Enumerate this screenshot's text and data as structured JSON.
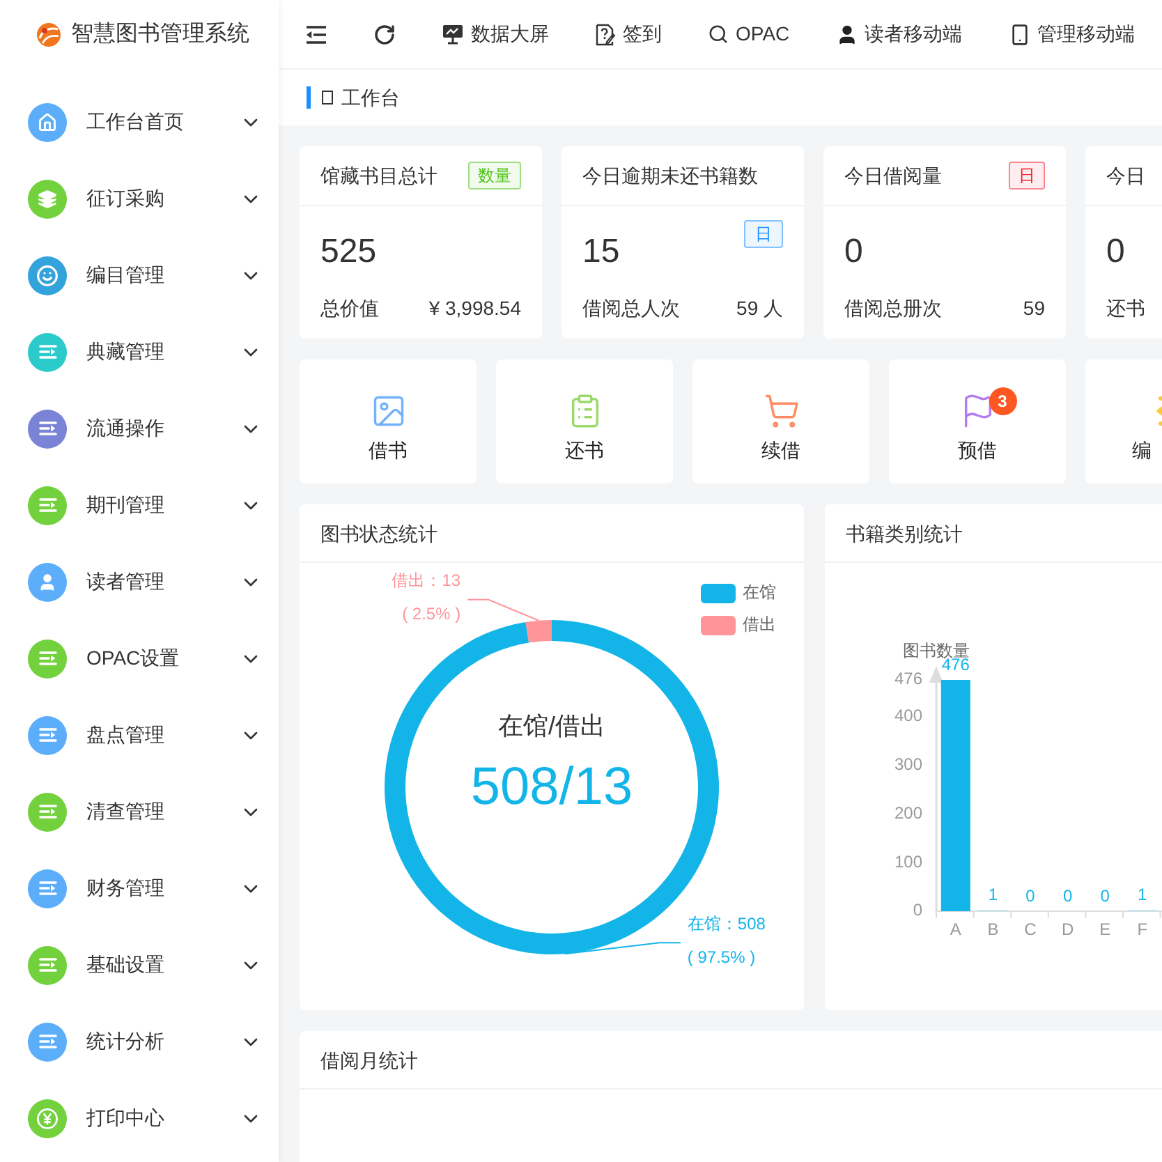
{
  "app": {
    "title": "智慧图书管理系统"
  },
  "toolbar": {
    "items": [
      {
        "kind": "indent"
      },
      {
        "kind": "refresh"
      },
      {
        "kind": "monitor",
        "label": "数据大屏"
      },
      {
        "kind": "document",
        "label": "签到"
      },
      {
        "kind": "search",
        "label": "OPAC"
      },
      {
        "kind": "user",
        "label": "读者移动端"
      },
      {
        "kind": "phone",
        "label": "管理移动端"
      }
    ]
  },
  "sidebar": {
    "items": [
      {
        "label": "工作台首页",
        "kind": "home",
        "color": "#5caefa"
      },
      {
        "label": "征订采购",
        "kind": "layers",
        "color": "#72d13c"
      },
      {
        "label": "编目管理",
        "kind": "smile",
        "color": "#33a3dc"
      },
      {
        "label": "典藏管理",
        "kind": "list",
        "color": "#2ccbcb"
      },
      {
        "label": "流通操作",
        "kind": "list",
        "color": "#7b83d6"
      },
      {
        "label": "期刊管理",
        "kind": "list",
        "color": "#72d13c"
      },
      {
        "label": "读者管理",
        "kind": "user",
        "color": "#5caefa"
      },
      {
        "label": "OPAC设置",
        "kind": "list",
        "color": "#72d13c"
      },
      {
        "label": "盘点管理",
        "kind": "list",
        "color": "#5caefa"
      },
      {
        "label": "清查管理",
        "kind": "list",
        "color": "#72d13c"
      },
      {
        "label": "财务管理",
        "kind": "list",
        "color": "#5caefa"
      },
      {
        "label": "基础设置",
        "kind": "list",
        "color": "#72d13c"
      },
      {
        "label": "统计分析",
        "kind": "list",
        "color": "#5caefa"
      },
      {
        "label": "打印中心",
        "kind": "yen",
        "color": "#72d13c"
      }
    ]
  },
  "breadcrumb": {
    "label": "工作台"
  },
  "stat_cards": [
    {
      "title": "馆藏书目总计",
      "header_badge": {
        "text": "数量",
        "color": "#52c41a"
      },
      "value": "525",
      "footer_label": "总价值",
      "footer_value": "¥ 3,998.54"
    },
    {
      "title": "今日逾期未还书籍数",
      "body_badge": {
        "text": "日",
        "color": "#1890ff"
      },
      "value": "15",
      "footer_label": "借阅总人次",
      "footer_value": "59 人"
    },
    {
      "title": "今日借阅量",
      "header_badge": {
        "text": "日",
        "color": "#f5222d"
      },
      "value": "0",
      "footer_label": "借阅总册次",
      "footer_value": "59"
    },
    {
      "title": "今日",
      "value": "0",
      "footer_label": "还书"
    }
  ],
  "quick_actions": [
    {
      "label": "借书",
      "kind": "image",
      "color": "#73b2fb"
    },
    {
      "label": "还书",
      "kind": "clipboard",
      "color": "#9bd96a"
    },
    {
      "label": "续借",
      "kind": "cart",
      "color": "#ff8c62"
    },
    {
      "label": "预借",
      "kind": "flag",
      "color": "#b57ef0",
      "badge": "3"
    },
    {
      "label": "编",
      "kind": "list",
      "color": "#fcc93a"
    }
  ],
  "status_panel": {
    "title": "图书状态统计",
    "center_label": "在馆/借出",
    "center_value": "508/13",
    "legend": [
      {
        "label": "在馆",
        "color": "#13b5e8"
      },
      {
        "label": "借出",
        "color": "#ff9499"
      }
    ],
    "slice_labels": [
      {
        "text": "在馆：508",
        "percent": "( 97.5% )"
      },
      {
        "text": "借出：13",
        "percent": "( 2.5% )"
      }
    ],
    "chart_data": {
      "type": "donut",
      "values": [
        97.5,
        2.5
      ]
    }
  },
  "category_panel": {
    "title": "书籍类别统计",
    "chart_data": {
      "type": "bar",
      "ylabel": "图书数量",
      "categories": [
        "A",
        "B",
        "C",
        "D",
        "E",
        "F"
      ],
      "values": [
        476,
        1,
        0,
        0,
        0,
        1
      ],
      "ylim": [
        0,
        476
      ],
      "yticks": [
        0,
        100,
        200,
        300,
        400,
        476
      ],
      "data_labels": true
    }
  },
  "monthly_panel": {
    "title": "借阅月统计"
  }
}
